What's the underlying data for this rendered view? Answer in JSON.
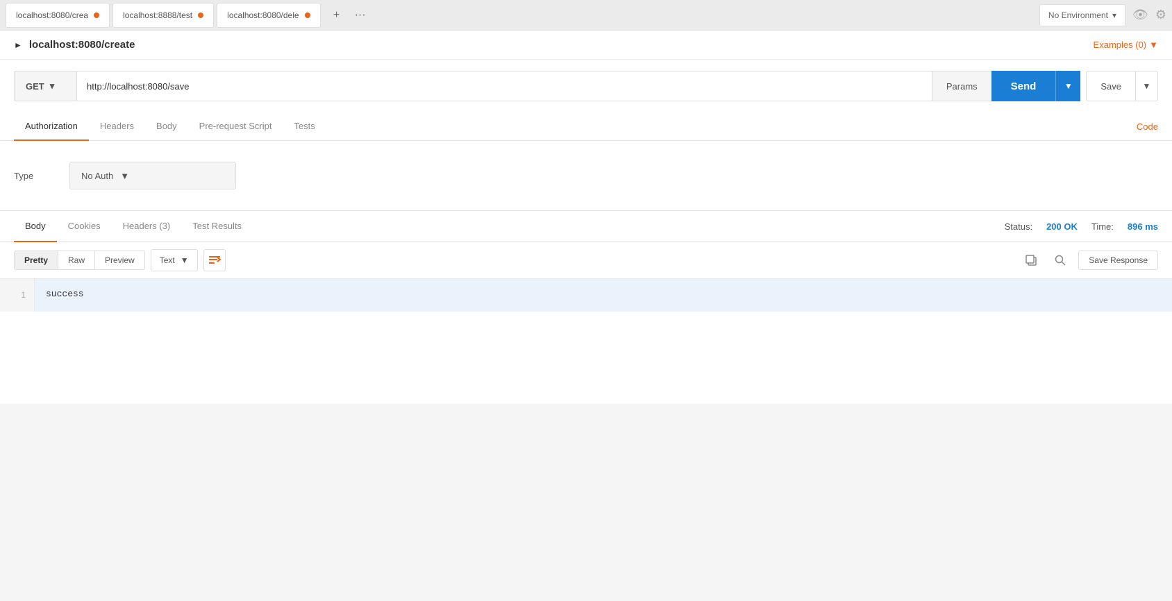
{
  "tabs": [
    {
      "id": "tab1",
      "label": "localhost:8080/crea",
      "hasDot": true
    },
    {
      "id": "tab2",
      "label": "localhost:8888/test",
      "hasDot": true
    },
    {
      "id": "tab3",
      "label": "localhost:8080/dele",
      "hasDot": true
    }
  ],
  "tab_add_label": "+",
  "tab_more_label": "···",
  "environment": {
    "label": "No Environment",
    "chevron": "▾"
  },
  "icons": {
    "eye": "👁",
    "gear": "⚙"
  },
  "request_title": "localhost:8080/create",
  "examples_label": "Examples (0)",
  "method": {
    "value": "GET",
    "chevron": "▾"
  },
  "url": "http://localhost:8080/save",
  "params_label": "Params",
  "send_label": "Send",
  "save_label": "Save",
  "req_tabs": [
    {
      "id": "authorization",
      "label": "Authorization",
      "active": true
    },
    {
      "id": "headers",
      "label": "Headers"
    },
    {
      "id": "body",
      "label": "Body"
    },
    {
      "id": "pre-request",
      "label": "Pre-request Script"
    },
    {
      "id": "tests",
      "label": "Tests"
    }
  ],
  "code_label": "Code",
  "auth": {
    "type_label": "Type",
    "value": "No Auth"
  },
  "response": {
    "tabs": [
      {
        "id": "body",
        "label": "Body",
        "active": true
      },
      {
        "id": "cookies",
        "label": "Cookies"
      },
      {
        "id": "headers",
        "label": "Headers (3)"
      },
      {
        "id": "test-results",
        "label": "Test Results"
      }
    ],
    "status_label": "Status:",
    "status_value": "200 OK",
    "time_label": "Time:",
    "time_value": "896 ms",
    "format_btns": [
      {
        "id": "pretty",
        "label": "Pretty",
        "active": true
      },
      {
        "id": "raw",
        "label": "Raw"
      },
      {
        "id": "preview",
        "label": "Preview"
      }
    ],
    "text_format": "Text",
    "save_response_label": "Save Response",
    "lines": [
      {
        "num": "1",
        "content": "success"
      }
    ]
  }
}
